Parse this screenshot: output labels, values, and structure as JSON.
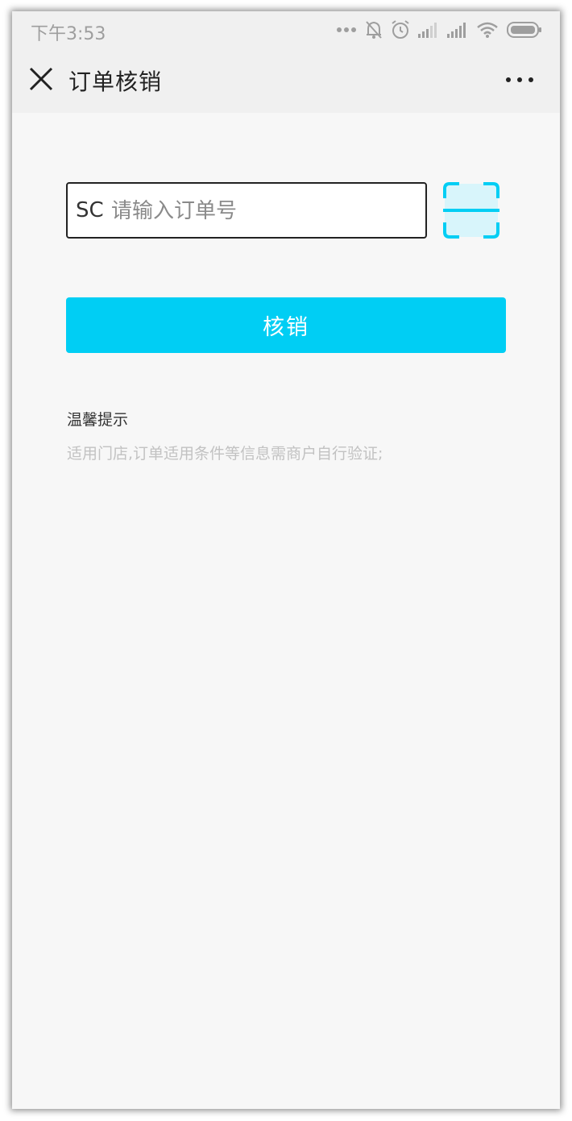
{
  "statusbar": {
    "time": "下午3:53",
    "icons": [
      "more-dots-icon",
      "bell-muted-icon",
      "alarm-icon",
      "signal-icon",
      "signal-icon",
      "wifi-icon",
      "battery-icon"
    ]
  },
  "navbar": {
    "title": "订单核销",
    "close_icon": "close-icon",
    "more_icon": "more-horizontal-icon"
  },
  "form": {
    "prefix": "SC",
    "order_input_value": "",
    "order_input_placeholder": "请输入订单号",
    "scan_icon": "scan-icon",
    "submit_label": "核销"
  },
  "tips": {
    "title": "温馨提示",
    "text": "适用门店,订单适用条件等信息需商户自行验证;"
  },
  "colors": {
    "accent": "#00cef4",
    "scan_fill": "#d8f5fb",
    "background": "#f7f7f7",
    "bar_background": "#f0f0f0",
    "hint_text": "#c2c2c2"
  }
}
